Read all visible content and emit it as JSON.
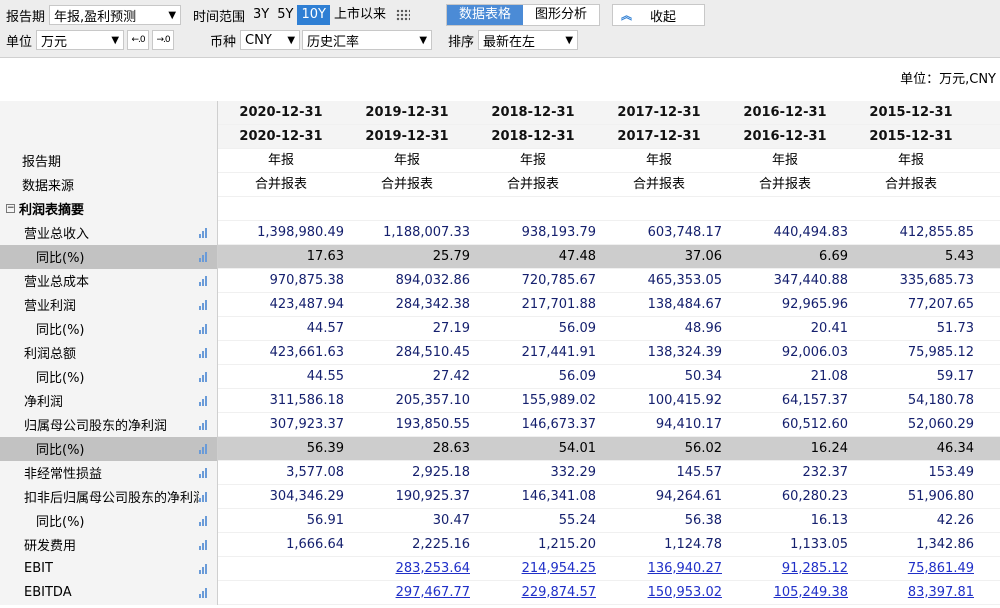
{
  "toolbar": {
    "report_period_label": "报告期",
    "report_period_value": "年报,盈利预测",
    "time_range_label": "时间范围",
    "range_3y": "3Y",
    "range_5y": "5Y",
    "range_10y": "10Y",
    "range_since_ipo": "上市以来",
    "tab_table": "数据表格",
    "tab_chart": "图形分析",
    "collapse": "收起",
    "unit_label": "单位",
    "unit_value": "万元",
    "currency_label": "币种",
    "currency_value": "CNY",
    "fx_value": "历史汇率",
    "sort_label": "排序",
    "sort_value": "最新在左"
  },
  "unit_note": "单位：万元,CNY",
  "columns": [
    "2020-12-31",
    "2019-12-31",
    "2018-12-31",
    "2017-12-31",
    "2016-12-31",
    "2015-12-31"
  ],
  "header_rows": {
    "date2": [
      "2020-12-31",
      "2019-12-31",
      "2018-12-31",
      "2017-12-31",
      "2016-12-31",
      "2015-12-31"
    ],
    "report_period": {
      "label": "报告期",
      "values": [
        "年报",
        "年报",
        "年报",
        "年报",
        "年报",
        "年报"
      ]
    },
    "data_source": {
      "label": "数据来源",
      "values": [
        "合并报表",
        "合并报表",
        "合并报表",
        "合并报表",
        "合并报表",
        "合并报表"
      ]
    }
  },
  "section": {
    "label": "利润表摘要",
    "toggle": "⊟"
  },
  "rows": [
    {
      "label": "营业总收入",
      "values": [
        "1,398,980.49",
        "1,188,007.33",
        "938,193.79",
        "603,748.17",
        "440,494.83",
        "412,855.85"
      ]
    },
    {
      "label": "同比(%)",
      "values": [
        "17.63",
        "25.79",
        "47.48",
        "37.06",
        "6.69",
        "5.43"
      ]
    },
    {
      "label": "营业总成本",
      "values": [
        "970,875.38",
        "894,032.86",
        "720,785.67",
        "465,353.05",
        "347,440.88",
        "335,685.73"
      ]
    },
    {
      "label": "营业利润",
      "values": [
        "423,487.94",
        "284,342.38",
        "217,701.88",
        "138,484.67",
        "92,965.96",
        "77,207.65"
      ]
    },
    {
      "label": "同比(%)",
      "values": [
        "44.57",
        "27.19",
        "56.09",
        "48.96",
        "20.41",
        "51.73"
      ]
    },
    {
      "label": "利润总额",
      "values": [
        "423,661.63",
        "284,510.45",
        "217,441.91",
        "138,324.39",
        "92,006.03",
        "75,985.12"
      ]
    },
    {
      "label": "同比(%)",
      "values": [
        "44.55",
        "27.42",
        "56.09",
        "50.34",
        "21.08",
        "59.17"
      ]
    },
    {
      "label": "净利润",
      "values": [
        "311,586.18",
        "205,357.10",
        "155,989.02",
        "100,415.92",
        "64,157.37",
        "54,180.78"
      ]
    },
    {
      "label": "归属母公司股东的净利润",
      "values": [
        "307,923.37",
        "193,850.55",
        "146,673.37",
        "94,410.17",
        "60,512.60",
        "52,060.29"
      ]
    },
    {
      "label": "同比(%)",
      "values": [
        "56.39",
        "28.63",
        "54.01",
        "56.02",
        "16.24",
        "46.34"
      ]
    },
    {
      "label": "非经常性损益",
      "values": [
        "3,577.08",
        "2,925.18",
        "332.29",
        "145.57",
        "232.37",
        "153.49"
      ]
    },
    {
      "label": "扣非后归属母公司股东的净利润",
      "values": [
        "304,346.29",
        "190,925.37",
        "146,341.08",
        "94,264.61",
        "60,280.23",
        "51,906.80"
      ]
    },
    {
      "label": "同比(%)",
      "values": [
        "56.91",
        "30.47",
        "55.24",
        "56.38",
        "16.13",
        "42.26"
      ]
    },
    {
      "label": "研发费用",
      "values": [
        "1,666.64",
        "2,225.16",
        "1,215.20",
        "1,124.78",
        "1,133.05",
        "1,342.86"
      ]
    },
    {
      "label": "EBIT",
      "values": [
        "",
        "283,253.64",
        "214,954.25",
        "136,940.27",
        "91,285.12",
        "75,861.49"
      ]
    },
    {
      "label": "EBITDA",
      "values": [
        "",
        "297,467.77",
        "229,874.57",
        "150,953.02",
        "105,249.38",
        "83,397.81"
      ]
    }
  ],
  "colors": {
    "accent": "#2f7fd4",
    "highlight_row": "#cdcdcd",
    "number_text": "#15206e",
    "link": "#2030c8"
  },
  "icons": {
    "row_chart": "bar-chart-icon",
    "grid": "grid-icon",
    "collapse": "chevron-up-icon"
  }
}
